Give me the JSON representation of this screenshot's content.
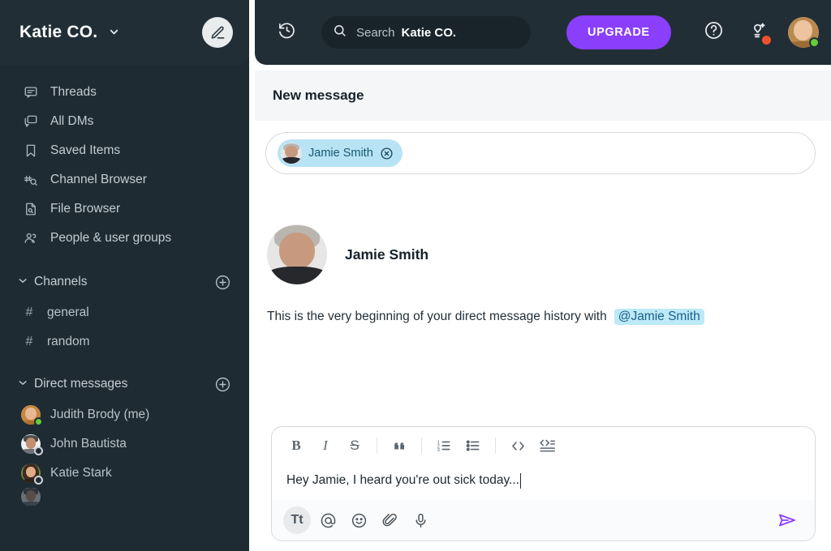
{
  "colors": {
    "sidebar_bg": "#1f2b33",
    "topbar_bg": "#222e36",
    "accent_purple": "#8a3ffc",
    "chip_blue": "#b8e3f5",
    "mention_blue": "#bde9f8",
    "online_green": "#63cd3b",
    "badge_orange": "#f1512a",
    "panel_head_bg": "#f4f6f8"
  },
  "sidebar": {
    "workspace": {
      "name": "Katie CO.",
      "chevron_icon": "chevron-down-icon"
    },
    "compose": {
      "icon": "pencil-icon",
      "label": "Compose"
    },
    "nav": [
      {
        "label": "Threads",
        "icon": "threads-icon"
      },
      {
        "label": "All DMs",
        "icon": "all-dms-icon"
      },
      {
        "label": "Saved Items",
        "icon": "bookmark-icon"
      },
      {
        "label": "Channel Browser",
        "icon": "channel-browser-icon"
      },
      {
        "label": "File Browser",
        "icon": "file-browser-icon"
      },
      {
        "label": "People & user groups",
        "icon": "people-icon"
      }
    ],
    "channels_section": {
      "title": "Channels",
      "caret_icon": "chevron-down-icon",
      "add_icon": "plus-circle-icon"
    },
    "channels": [
      {
        "hash": "#",
        "name": "general"
      },
      {
        "hash": "#",
        "name": "random"
      }
    ],
    "dm_section": {
      "title": "Direct messages",
      "caret_icon": "chevron-down-icon",
      "add_icon": "plus-circle-icon"
    },
    "dms": [
      {
        "name": "Judith Brody (me)",
        "status": "online",
        "avatar": "f-judith"
      },
      {
        "name": "John Bautista",
        "status": "offline",
        "avatar": "f-john"
      },
      {
        "name": "Katie Stark",
        "status": "offline",
        "avatar": "f-katie"
      }
    ]
  },
  "topbar": {
    "history_icon": "history-icon",
    "search": {
      "icon": "search-icon",
      "placeholder": "Search",
      "workspace": "Katie CO."
    },
    "upgrade_label": "UPGRADE",
    "help_icon": "help-circle-icon",
    "whats_new_icon": "lightbulb-icon",
    "whats_new_badge": "badge-dot",
    "avatar": {
      "name": "Judith Brody",
      "status": "online",
      "avatar": "f-me"
    }
  },
  "panel": {
    "title": "New message",
    "to_field": {
      "chip": {
        "name": "Jamie Smith",
        "avatar": "f-jamie",
        "remove_icon": "close-circle-icon"
      }
    }
  },
  "conversation": {
    "person": {
      "name": "Jamie Smith",
      "avatar": "f-jamie"
    },
    "intro_text": "This is the very beginning of your direct message history with",
    "mention": "@Jamie Smith"
  },
  "composer": {
    "format_buttons": [
      {
        "name": "bold",
        "glyph": "B"
      },
      {
        "name": "italic",
        "glyph": "I"
      },
      {
        "name": "strikethrough",
        "glyph": "S"
      },
      {
        "name": "blockquote",
        "glyph": "””"
      },
      {
        "name": "ordered-list",
        "glyph": ""
      },
      {
        "name": "bulleted-list",
        "glyph": ""
      },
      {
        "name": "code",
        "glyph": "< >"
      },
      {
        "name": "code-block",
        "glyph": ""
      }
    ],
    "message_text": "Hey Jamie, I heard you're out sick today...",
    "action_buttons": [
      {
        "name": "formatting-toggle",
        "glyph": "Tt",
        "active": true
      },
      {
        "name": "mention",
        "glyph": "@",
        "active": false
      },
      {
        "name": "emoji",
        "glyph": "☺",
        "active": false
      },
      {
        "name": "attachment",
        "glyph": "",
        "active": false
      },
      {
        "name": "audio",
        "glyph": "",
        "active": false
      }
    ],
    "send_icon": "send-icon"
  }
}
